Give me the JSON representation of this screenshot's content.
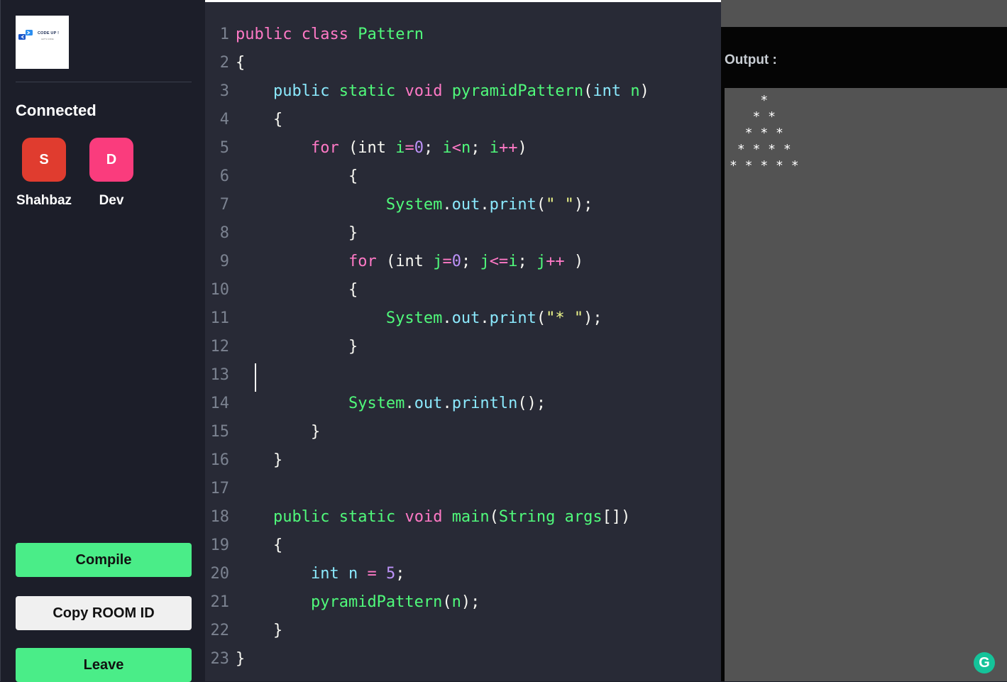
{
  "sidebar": {
    "logo_text": "CODE UP !",
    "logo_subtitle": "LET'S CODE",
    "connected_title": "Connected",
    "clients": [
      {
        "name": "Shahbaz",
        "initial": "S",
        "color": "#e03c2f"
      },
      {
        "name": "Dev",
        "initial": "D",
        "color": "#fa3c7d"
      }
    ],
    "buttons": {
      "compile": "Compile",
      "copy_room_id": "Copy ROOM ID",
      "leave": "Leave"
    }
  },
  "editor": {
    "language": "java",
    "cursor_line": 13,
    "lines": [
      [
        [
          "kw",
          "public"
        ],
        [
          "pl",
          " "
        ],
        [
          "kw",
          "class"
        ],
        [
          "pl",
          " "
        ],
        [
          "var",
          "Pattern"
        ]
      ],
      [
        [
          "pl",
          "{"
        ]
      ],
      [
        [
          "pl",
          "    "
        ],
        [
          "def",
          "public"
        ],
        [
          "pl",
          " "
        ],
        [
          "var",
          "static"
        ],
        [
          "pl",
          " "
        ],
        [
          "kw",
          "void"
        ],
        [
          "pl",
          " "
        ],
        [
          "var",
          "pyramidPattern"
        ],
        [
          "pl",
          "("
        ],
        [
          "def",
          "int"
        ],
        [
          "pl",
          " "
        ],
        [
          "var",
          "n"
        ],
        [
          "pl",
          ")"
        ]
      ],
      [
        [
          "pl",
          "    {"
        ]
      ],
      [
        [
          "pl",
          "        "
        ],
        [
          "kw",
          "for"
        ],
        [
          "pl",
          " (int "
        ],
        [
          "var",
          "i"
        ],
        [
          "op",
          "="
        ],
        [
          "num",
          "0"
        ],
        [
          "pl",
          "; "
        ],
        [
          "var",
          "i"
        ],
        [
          "op",
          "<"
        ],
        [
          "var",
          "n"
        ],
        [
          "pl",
          "; "
        ],
        [
          "var",
          "i"
        ],
        [
          "op",
          "++"
        ],
        [
          "pl",
          ")"
        ]
      ],
      [
        [
          "pl",
          "            {"
        ]
      ],
      [
        [
          "pl",
          "                "
        ],
        [
          "var",
          "System"
        ],
        [
          "pl",
          "."
        ],
        [
          "def",
          "out"
        ],
        [
          "pl",
          "."
        ],
        [
          "def",
          "print"
        ],
        [
          "pl",
          "("
        ],
        [
          "str",
          "\" \""
        ],
        [
          "pl",
          ");"
        ]
      ],
      [
        [
          "pl",
          "            }"
        ]
      ],
      [
        [
          "pl",
          "            "
        ],
        [
          "kw",
          "for"
        ],
        [
          "pl",
          " (int "
        ],
        [
          "var",
          "j"
        ],
        [
          "op",
          "="
        ],
        [
          "num",
          "0"
        ],
        [
          "pl",
          "; "
        ],
        [
          "var",
          "j"
        ],
        [
          "op",
          "<="
        ],
        [
          "var",
          "i"
        ],
        [
          "pl",
          "; "
        ],
        [
          "var",
          "j"
        ],
        [
          "op",
          "++"
        ],
        [
          "pl",
          " )"
        ]
      ],
      [
        [
          "pl",
          "            {"
        ]
      ],
      [
        [
          "pl",
          "                "
        ],
        [
          "var",
          "System"
        ],
        [
          "pl",
          "."
        ],
        [
          "def",
          "out"
        ],
        [
          "pl",
          "."
        ],
        [
          "def",
          "print"
        ],
        [
          "pl",
          "("
        ],
        [
          "str",
          "\"* \""
        ],
        [
          "pl",
          ");"
        ]
      ],
      [
        [
          "pl",
          "            }"
        ]
      ],
      [],
      [
        [
          "pl",
          "            "
        ],
        [
          "var",
          "System"
        ],
        [
          "pl",
          "."
        ],
        [
          "def",
          "out"
        ],
        [
          "pl",
          "."
        ],
        [
          "def",
          "println"
        ],
        [
          "pl",
          "();"
        ]
      ],
      [
        [
          "pl",
          "        }"
        ]
      ],
      [
        [
          "pl",
          "    }"
        ]
      ],
      [],
      [
        [
          "pl",
          "    "
        ],
        [
          "var",
          "public"
        ],
        [
          "pl",
          " "
        ],
        [
          "var",
          "static"
        ],
        [
          "pl",
          " "
        ],
        [
          "kw",
          "void"
        ],
        [
          "pl",
          " "
        ],
        [
          "var",
          "main"
        ],
        [
          "pl",
          "("
        ],
        [
          "var",
          "String"
        ],
        [
          "pl",
          " "
        ],
        [
          "var",
          "args"
        ],
        [
          "pl",
          "[])"
        ]
      ],
      [
        [
          "pl",
          "    {"
        ]
      ],
      [
        [
          "pl",
          "        "
        ],
        [
          "def",
          "int"
        ],
        [
          "pl",
          " "
        ],
        [
          "def",
          "n"
        ],
        [
          "pl",
          " "
        ],
        [
          "op",
          "="
        ],
        [
          "pl",
          " "
        ],
        [
          "num",
          "5"
        ],
        [
          "pl",
          ";"
        ]
      ],
      [
        [
          "pl",
          "        "
        ],
        [
          "var",
          "pyramidPattern"
        ],
        [
          "pl",
          "("
        ],
        [
          "var",
          "n"
        ],
        [
          "pl",
          ");"
        ]
      ],
      [
        [
          "pl",
          "    }"
        ]
      ],
      [
        [
          "pl",
          "}"
        ]
      ]
    ]
  },
  "output": {
    "label": "Output :",
    "text": "    * \n   * * \n  * * * \n * * * * \n* * * * * "
  },
  "grammarly_icon_letter": "G"
}
